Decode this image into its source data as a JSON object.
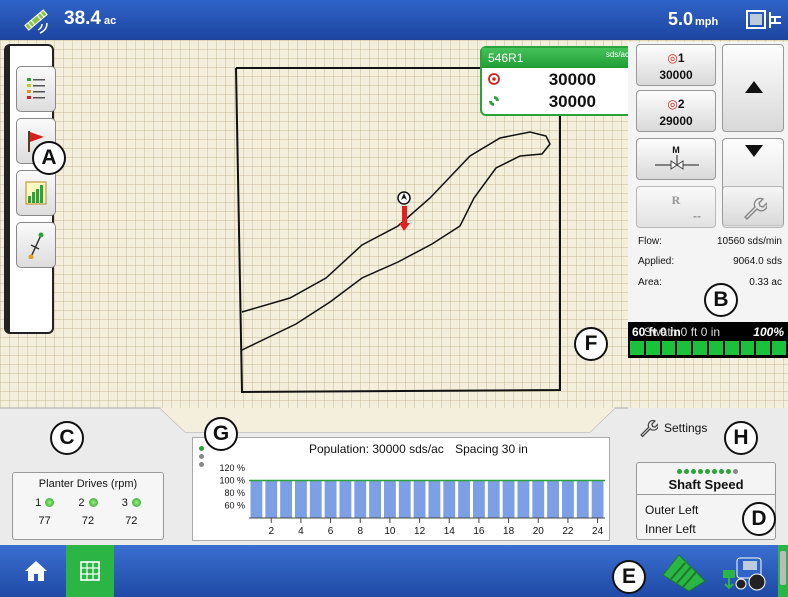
{
  "topbar": {
    "area_value": "38.4",
    "area_unit": "ac",
    "speed_value": "5.0",
    "speed_unit": "mph"
  },
  "product": {
    "name": "546R1",
    "unit": "sds/ac",
    "target_rate": "30000",
    "actual_rate": "30000"
  },
  "rate_buttons": {
    "rate1_label": "1",
    "rate1_value": "30000",
    "rate2_label": "2",
    "rate2_value": "29000",
    "manual_label": "M",
    "rx_label": "R",
    "rx_value": "--"
  },
  "stats": {
    "flow_label": "Flow:",
    "flow_value": "10560 sds/min",
    "applied_label": "Applied:",
    "applied_value": "9064.0 sds",
    "area_label": "Area:",
    "area_value": "0.33 ac"
  },
  "swath": {
    "text": "60 ft 0 in",
    "overlap_text": "Swath 0 ft 0 in",
    "percent": "100%",
    "section_count": 10
  },
  "callouts": [
    "A",
    "B",
    "C",
    "D",
    "E",
    "F",
    "G",
    "H"
  ],
  "planter_drives": {
    "title": "Planter Drives (rpm)",
    "drives": [
      {
        "num": "1",
        "rpm": "77"
      },
      {
        "num": "2",
        "rpm": "72"
      },
      {
        "num": "3",
        "rpm": "72"
      }
    ]
  },
  "population_graph": {
    "title": "Population: 30000 sds/ac",
    "spacing": "Spacing 30 in",
    "y_labels": [
      "120 %",
      "100 %",
      "80 %",
      "60 %"
    ],
    "x_labels": [
      "2",
      "4",
      "6",
      "8",
      "10",
      "12",
      "14",
      "16",
      "18",
      "20",
      "22",
      "24"
    ],
    "row_values_pct": [
      100,
      100,
      100,
      100,
      100,
      100,
      100,
      100,
      100,
      100,
      100,
      100,
      100,
      100,
      100,
      100,
      100,
      100,
      100,
      100,
      100,
      100,
      100,
      100
    ]
  },
  "settings": {
    "label": "Settings"
  },
  "shaft_speed": {
    "title": "Shaft Speed",
    "row1": "Outer Left",
    "row2": "Inner Left"
  },
  "colors": {
    "accent_green": "#2aa339",
    "bar_blue": "#7d9fe6",
    "top_blue": "#2f63c8"
  },
  "icons": [
    "gps-icon",
    "view-split-icon",
    "home-icon",
    "grid-icon",
    "field-ops-icon",
    "tractor-icon",
    "wrench-icon"
  ]
}
